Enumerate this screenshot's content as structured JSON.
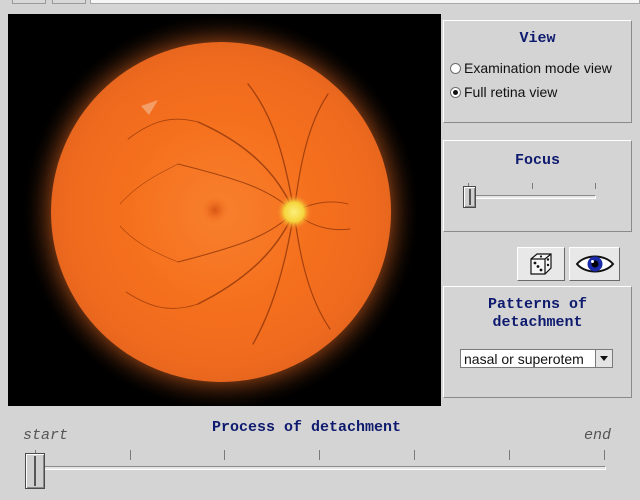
{
  "view_panel": {
    "title": "View",
    "options": [
      {
        "label": "Examination mode view",
        "selected": false
      },
      {
        "label": "Full retina view",
        "selected": true
      }
    ]
  },
  "focus_panel": {
    "title": "Focus",
    "slider_value_fraction": 0.0
  },
  "tool_buttons": {
    "dice_icon": "dice-icon",
    "eye_icon": "eye-icon"
  },
  "patterns_panel": {
    "title_line1": "Patterns of",
    "title_line2": "detachment",
    "selected_pattern": "nasal or superotem"
  },
  "process": {
    "title": "Process of detachment",
    "start_label": "start",
    "end_label": "end",
    "slider_value_fraction": 0.0
  },
  "colors": {
    "panel_title": "#0d1a6e",
    "retina": "#f5701d",
    "optic_disc": "#f6e94a",
    "background": "#d4d4d4"
  }
}
